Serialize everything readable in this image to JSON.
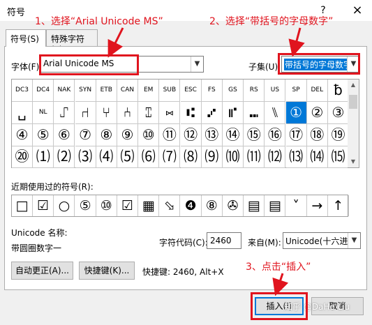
{
  "window": {
    "title": "符号",
    "help_icon": "?",
    "close_icon": "×"
  },
  "tabs": [
    {
      "label": "符号(S)"
    },
    {
      "label": "特殊字符(P)"
    }
  ],
  "font": {
    "label": "字体(F):",
    "value": "Arial Unicode MS"
  },
  "subset": {
    "label": "子集(U):",
    "value": "带括号的字母数字"
  },
  "symbol_grid": {
    "rows": [
      [
        "DC3",
        "DC4",
        "NAK",
        "SYN",
        "ETB",
        "CAN",
        "EM",
        "SUB",
        "ESC",
        "FS",
        "GS",
        "RS",
        "US",
        "SP",
        "DEL",
        "ƀ"
      ],
      [
        "␣",
        "NL",
        "⑀",
        "⑁",
        "⑂",
        "⑃",
        "⑄",
        "⑅",
        "⑆",
        "⑇",
        "⑈",
        "⑉",
        "⑊",
        "①",
        "②",
        "③"
      ],
      [
        "④",
        "⑤",
        "⑥",
        "⑦",
        "⑧",
        "⑨",
        "⑩",
        "⑪",
        "⑫",
        "⑬",
        "⑭",
        "⑮",
        "⑯",
        "⑰",
        "⑱",
        "⑲"
      ],
      [
        "⑳",
        "⑴",
        "⑵",
        "⑶",
        "⑷",
        "⑸",
        "⑹",
        "⑺",
        "⑻",
        "⑼",
        "⑽",
        "⑾",
        "⑿",
        "⒀",
        "⒁",
        "⒂"
      ]
    ],
    "selected": "①"
  },
  "recent": {
    "label": "近期使用过的符号(R):",
    "symbols": [
      "□",
      "☑",
      "○",
      "⑤",
      "⑩",
      "☑",
      "▦",
      "⬂",
      "❹",
      "⑧",
      "✇",
      "▤",
      "▤",
      "˅",
      "→",
      "↑"
    ]
  },
  "unicode_name": {
    "label": "Unicode 名称:",
    "value": "带圆圈数字一"
  },
  "char_code": {
    "label": "字符代码(C):",
    "value": "2460"
  },
  "from": {
    "label": "来自(M):",
    "value": "Unicode(十六进"
  },
  "buttons": {
    "autocorrect": "自动更正(A)...",
    "shortcut": "快捷键(K)...",
    "insert": "插入(I)",
    "cancel": "取消"
  },
  "shortcut_text": "快捷键: 2460, Alt+X",
  "annotations": {
    "step1": "1、选择“Arial Unicode MS”",
    "step2": "2、选择“带括号的字母数字”",
    "step3": "3、点击“插入”"
  },
  "watermark": "知乎 @DaHe Liu",
  "colors": {
    "annotation_red": "#e0141e",
    "selection_blue": "#0078d7"
  }
}
